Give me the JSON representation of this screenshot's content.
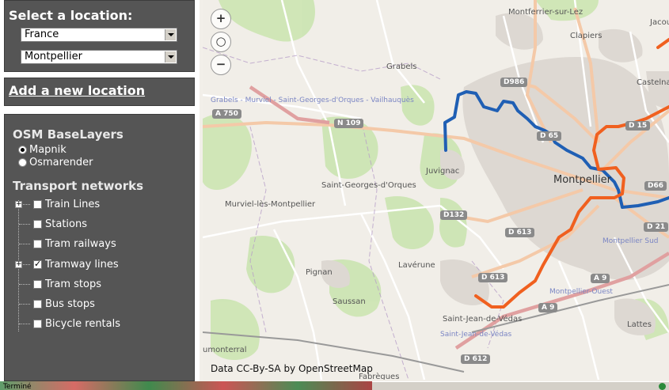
{
  "location": {
    "title": "Select a location:",
    "country": "France",
    "city": "Montpellier",
    "add_link": "Add a new location"
  },
  "layers": {
    "base_title": "OSM BaseLayers",
    "base_options": [
      {
        "label": "Mapnik",
        "selected": true
      },
      {
        "label": "Osmarender",
        "selected": false
      }
    ],
    "transport_title": "Transport networks",
    "items": [
      {
        "label": "Train Lines",
        "checked": false,
        "expandable": true
      },
      {
        "label": "Stations",
        "checked": false,
        "expandable": false
      },
      {
        "label": "Tram railways",
        "checked": false,
        "expandable": false
      },
      {
        "label": "Tramway lines",
        "checked": true,
        "expandable": true
      },
      {
        "label": "Tram stops",
        "checked": false,
        "expandable": false
      },
      {
        "label": "Bus stops",
        "checked": false,
        "expandable": false
      },
      {
        "label": "Bicycle rentals",
        "checked": false,
        "expandable": false
      }
    ]
  },
  "map": {
    "zoom_in_icon": "zoom-in-icon",
    "zoom_world_icon": "zoom-world-icon",
    "zoom_out_icon": "zoom-out-icon",
    "places": {
      "montferrier": "Montferrier-sur-Lez",
      "clapiers": "Clapiers",
      "jacou": "Jacou",
      "grabels": "Grabels",
      "castelnau": "Castelnau",
      "juvignac": "Juvignac",
      "montpellier": "Montpellier",
      "st_georges": "Saint-Georges-d'Orques",
      "murviel": "Murviel-lès-Montpellier",
      "laverune": "Lavérune",
      "pignan": "Pignan",
      "saussan": "Saussan",
      "st_jean": "Saint-Jean-de-Védas",
      "lattes": "Lattes",
      "fabregues": "Fabrègues",
      "montarnaud": "umonterral",
      "montpellier_sud": "Montpellier Sud",
      "montpellier_ouest": "Montpellier-Ouest"
    },
    "rail_labels": {
      "grabels_line": "Grabels - Murviel - Saint-Georges-d'Orques - Vailhauquès",
      "st_jean_rail": "Saint-Jean-de-Védas"
    },
    "roads": {
      "a750": "A 750",
      "n109": "N 109",
      "d986": "D986",
      "d65": "D 65",
      "d15": "D 15",
      "d66": "D66",
      "d21": "D 21",
      "d132": "D132",
      "d613a": "D 613",
      "d613b": "D 613",
      "a9a": "A 9",
      "a9b": "A 9",
      "d612": "D 612"
    },
    "attribution": "Data CC-By-SA by OpenStreetMap",
    "tram_colors": {
      "line1": "#1f5fb4",
      "line2": "#f0601f"
    }
  },
  "statusbar": {
    "text": "Terminé",
    "globe_icon": "internet-zone-icon"
  }
}
